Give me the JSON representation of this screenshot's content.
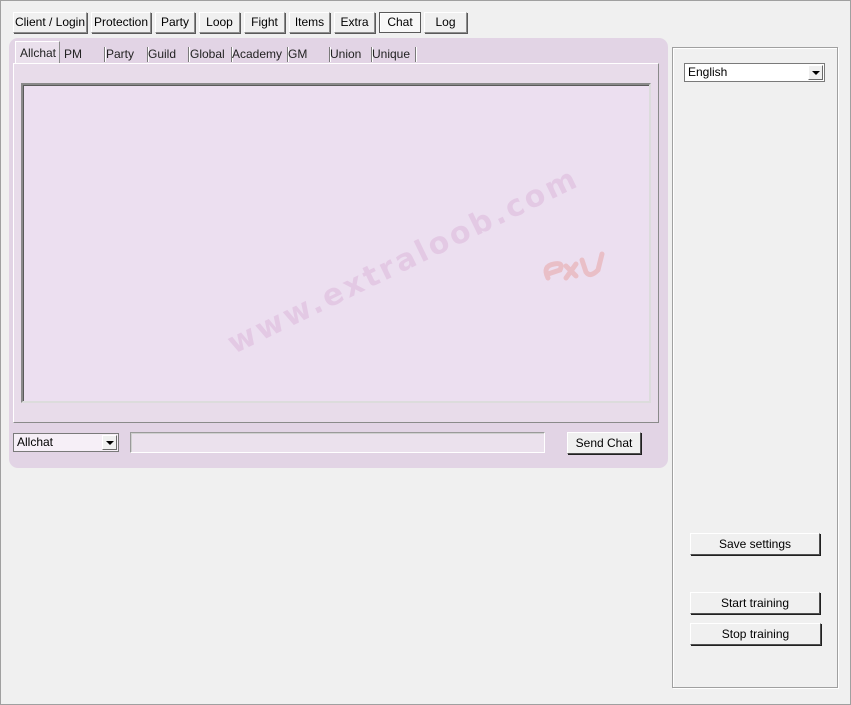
{
  "top_tabs": [
    {
      "label": "Client / Login"
    },
    {
      "label": "Protection"
    },
    {
      "label": "Party"
    },
    {
      "label": "Loop"
    },
    {
      "label": "Fight"
    },
    {
      "label": "Items"
    },
    {
      "label": "Extra"
    },
    {
      "label": "Chat",
      "active": true
    },
    {
      "label": "Log"
    }
  ],
  "chat": {
    "tabs": [
      {
        "label": "Allchat",
        "active": true
      },
      {
        "label": "PM"
      },
      {
        "label": "Party"
      },
      {
        "label": "Guild"
      },
      {
        "label": "Global"
      },
      {
        "label": "Academy"
      },
      {
        "label": "GM"
      },
      {
        "label": "Union"
      },
      {
        "label": "Unique"
      }
    ],
    "channel_selected": "Allchat",
    "message_value": "",
    "send_label": "Send Chat"
  },
  "settings": {
    "language_selected": "English",
    "save_label": "Save settings",
    "start_label": "Start training",
    "stop_label": "Stop training"
  },
  "watermark": "www.extraloob.com",
  "colors": {
    "panel_bg": "#e2d4e5",
    "chatlog_bg": "#ecdff0",
    "window_bg": "#f0f0f0"
  }
}
